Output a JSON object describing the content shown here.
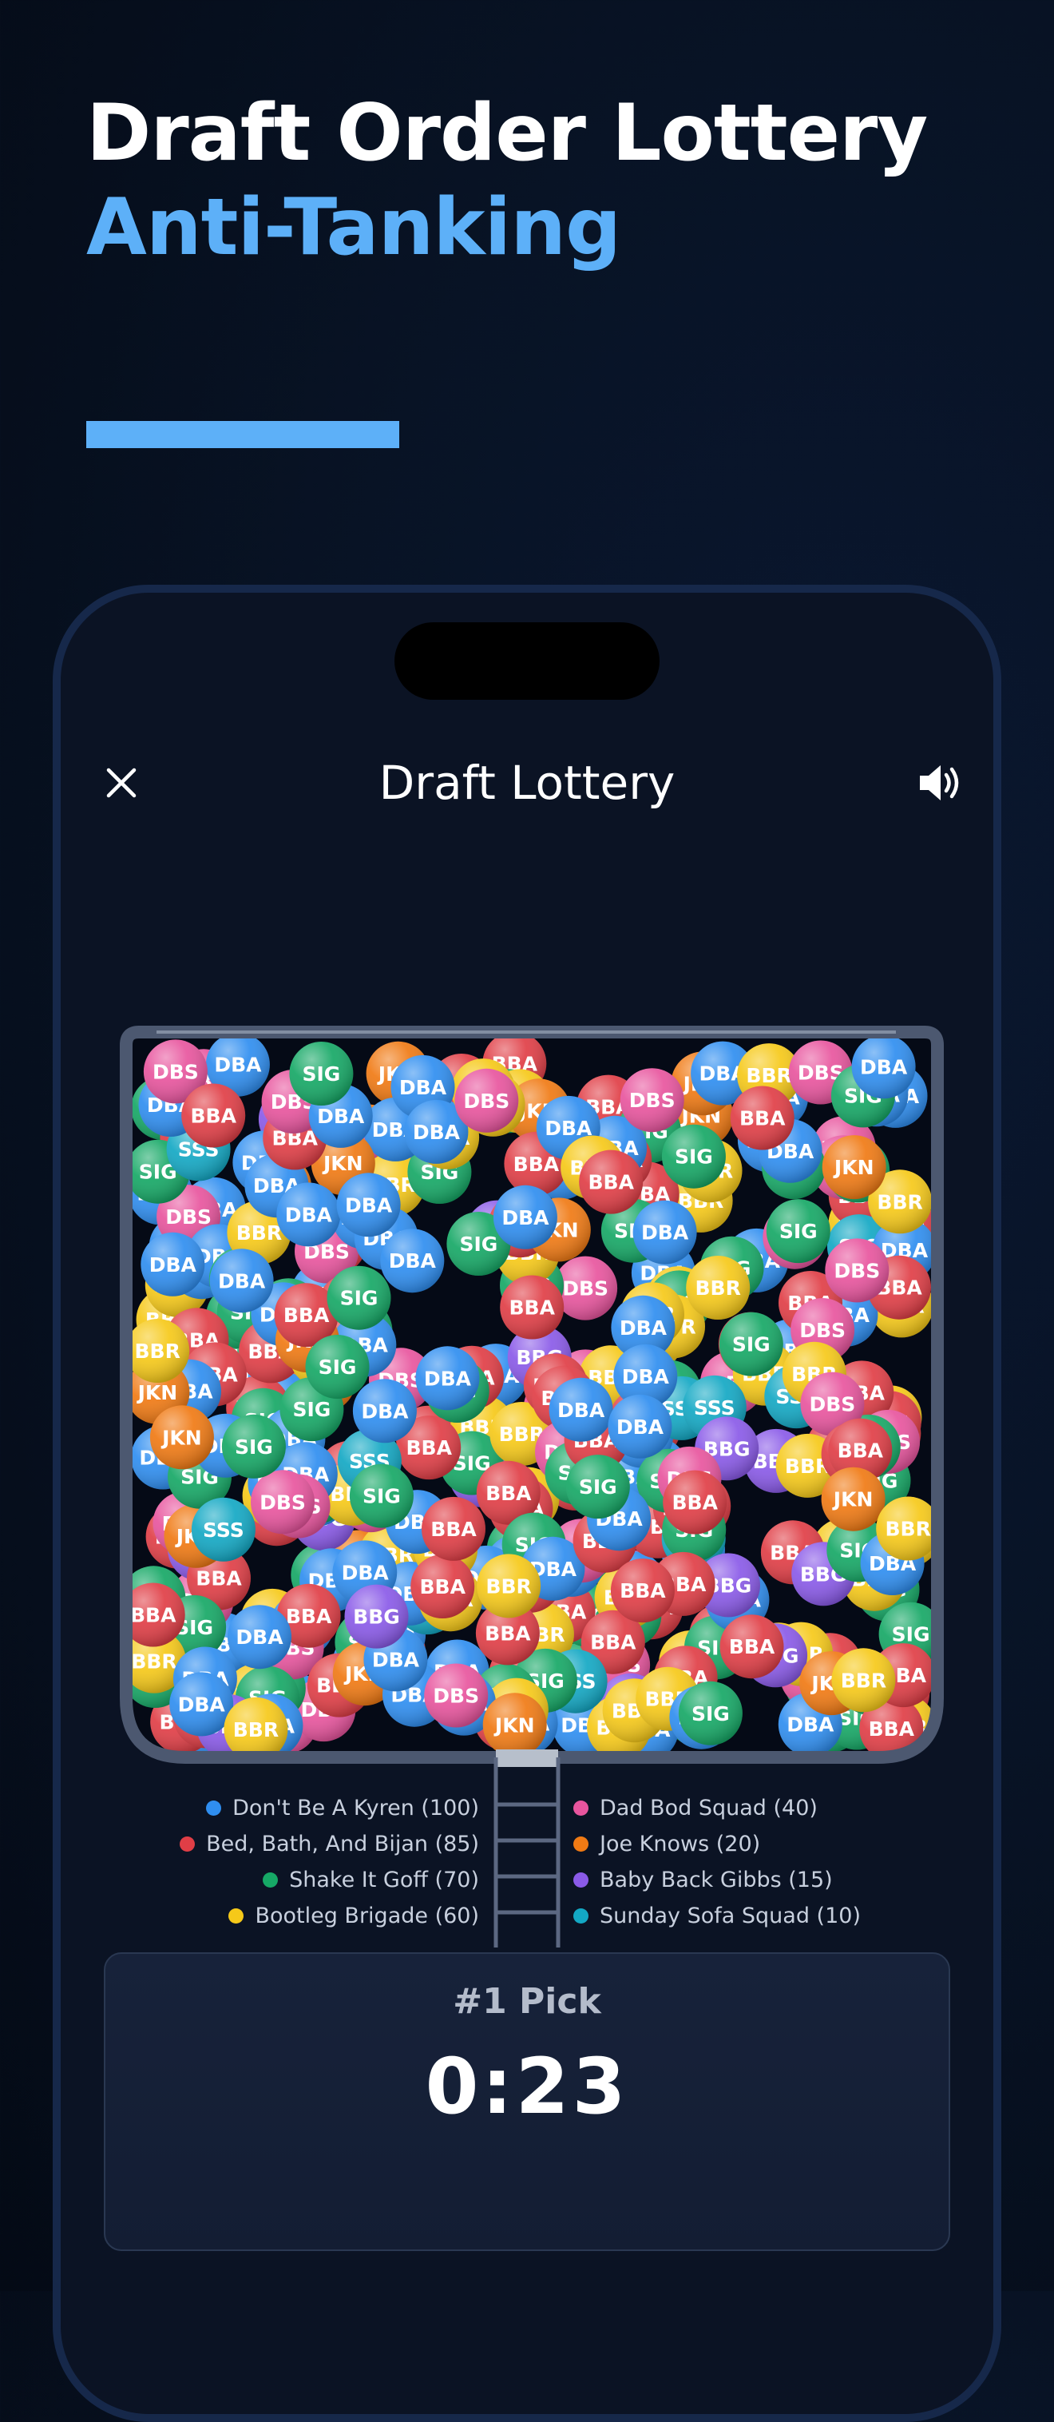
{
  "promo": {
    "title_line1": "Draft Order Lottery",
    "title_line2": "Anti-Tanking",
    "accent_color": "#5db0f8"
  },
  "header": {
    "title": "Draft Lottery",
    "close_icon": "close-icon",
    "sound_icon": "speaker-icon"
  },
  "teams": [
    {
      "abbr": "DBA",
      "label": "Don't Be A Kyren (100)",
      "color": "#2f8ef0",
      "count": 100
    },
    {
      "abbr": "BBA",
      "label": "Bed, Bath, And Bijan (85)",
      "color": "#e03e46",
      "count": 85
    },
    {
      "abbr": "SIG",
      "label": "Shake It Goff (70)",
      "color": "#16a866",
      "count": 70
    },
    {
      "abbr": "BBR",
      "label": "Bootleg Brigade (60)",
      "color": "#f6c919",
      "count": 60
    },
    {
      "abbr": "DBS",
      "label": "Dad Bod Squad (40)",
      "color": "#e8559e",
      "count": 40
    },
    {
      "abbr": "JKN",
      "label": "Joe Knows (20)",
      "color": "#f07a14",
      "count": 20
    },
    {
      "abbr": "BBG",
      "label": "Baby Back Gibbs (15)",
      "color": "#8a5ae8",
      "count": 15
    },
    {
      "abbr": "SSS",
      "label": "Sunday Sofa Squad (10)",
      "color": "#13a8c4",
      "count": 10
    }
  ],
  "pick": {
    "label": "#1 Pick",
    "timer": "0:23"
  }
}
